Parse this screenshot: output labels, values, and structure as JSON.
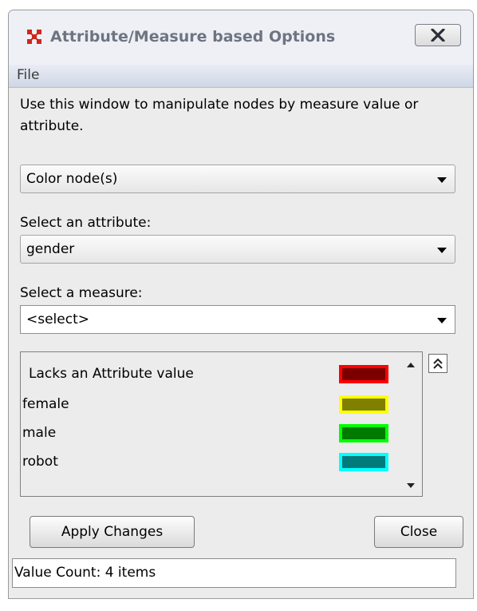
{
  "window": {
    "title": "Attribute/Measure based Options",
    "icon": "network-nodes-icon",
    "accent_color": "#d0271b"
  },
  "menu": {
    "file_label": "File"
  },
  "description": "Use this window to manipulate nodes by measure value or attribute.",
  "action_select": {
    "value": "Color node(s)"
  },
  "attribute": {
    "label": "Select an attribute:",
    "value": "gender"
  },
  "measure": {
    "label": "Select a measure:",
    "value": "<select>"
  },
  "legend": {
    "items": [
      {
        "label": "Lacks an Attribute value",
        "border": "#ff0000",
        "fill": "#7a0000"
      },
      {
        "label": "female",
        "border": "#ffff00",
        "fill": "#7f7f00"
      },
      {
        "label": "male",
        "border": "#00ff00",
        "fill": "#007a00"
      },
      {
        "label": "robot",
        "border": "#00ffff",
        "fill": "#007a7a"
      }
    ]
  },
  "buttons": {
    "apply_label": "Apply Changes",
    "close_label": "Close"
  },
  "status": {
    "text": "Value Count: 4 items"
  }
}
